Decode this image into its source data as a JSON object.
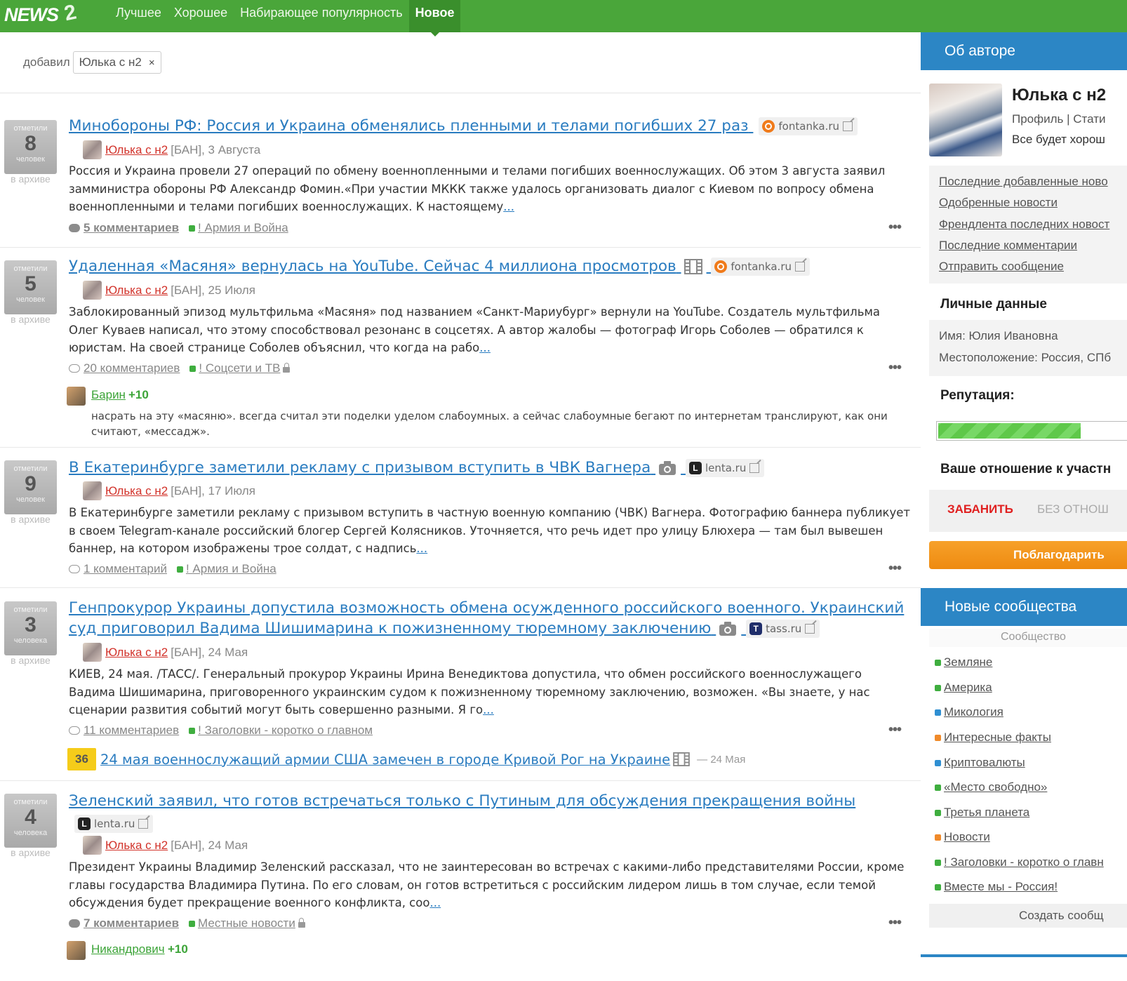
{
  "header": {
    "logo_text": "NEWS",
    "logo_badge": "2",
    "nav": [
      {
        "label": "Лучшее",
        "active": false
      },
      {
        "label": "Хорошее",
        "active": false
      },
      {
        "label": "Набирающее популярность",
        "active": false
      },
      {
        "label": "Новое",
        "active": true
      }
    ],
    "brand_color": "#4aa63a"
  },
  "filter": {
    "label": "добавил",
    "chip": "Юлька с н2",
    "clear": "×"
  },
  "news": [
    {
      "votes_top": "отметили",
      "votes": "8",
      "votes_bottom": "человек",
      "archive": "в архиве",
      "title": "Минобороны РФ: Россия и Украина обменялись пленными и телами погибших 27 раз",
      "media_icon": "",
      "source": "fontanka.ru",
      "source_icon": "fontanka-icon",
      "author": "Юлька с н2",
      "meta": "[БАН], 3 Августа",
      "text": "Россия и Украина провели 27 операций по обмену военнопленными и телами погибших военнослужащих. Об этом 3 августа заявил замминистра обороны РФ Александр Фомин.«При участии МККК также удалось организовать диалог с Киевом по вопросу обмена военнопленными и телами погибших военнослужащих. К настоящему",
      "more": "...",
      "comments": "5 комментариев",
      "category": "! Армия и Война",
      "category_locked": false
    },
    {
      "votes_top": "отметили",
      "votes": "5",
      "votes_bottom": "человек",
      "archive": "в архиве",
      "title": "Удаленная «Масяня» вернулась на YouTube. Сейчас 4 миллиона просмотров",
      "media_icon": "film-icon",
      "source": "fontanka.ru",
      "source_icon": "fontanka-icon",
      "author": "Юлька с н2",
      "meta": "[БАН], 25 Июля",
      "text": "Заблокированный эпизод мультфильма «Масяня» под названием «Санкт-Мариубург» вернули на YouTube. Создатель мультфильма Олег Куваев написал, что этому способствовал резонанс в соцсетях. А автор жалобы — фотограф Игорь Соболев — обратился к юристам. На своей странице Соболев объяснил, что когда на рабо",
      "more": "...",
      "comments": "20 комментариев",
      "category": "! Соцсети и ТВ",
      "category_locked": true,
      "comment": {
        "name": "Барин",
        "score": "+10",
        "text": "насрать на эту «масяню». всегда считал эти поделки уделом слабоумных. а сейчас слабоумные бегают по интернетам транслируют, как они считают, «мессадж»."
      }
    },
    {
      "votes_top": "отметили",
      "votes": "9",
      "votes_bottom": "человек",
      "archive": "в архиве",
      "title": "В Екатеринбурге заметили рекламу с призывом вступить в ЧВК Вагнера",
      "media_icon": "camera-icon",
      "source": "lenta.ru",
      "source_icon": "lenta-icon",
      "author": "Юлька с н2",
      "meta": "[БАН], 17 Июля",
      "text": " В Екатеринбурге заметили рекламу с призывом вступить в частную военную компанию (ЧВК) Вагнера. Фотографию баннера публикует в своем Telegram-канале российский блогер Сергей Колясников. Уточняется, что речь идет про улицу Блюхера — там был вывешен баннер, на котором изображены трое солдат, с надпись",
      "more": "...",
      "comments": "1 комментарий",
      "category": "! Армия и Война",
      "category_locked": false
    },
    {
      "votes_top": "отметили",
      "votes": "3",
      "votes_bottom": "человека",
      "archive": "в архиве",
      "title": "Генпрокурор Украины допустила возможность обмена осужденного российского военного. Украинский суд приговорил Вадима Шишимарина к пожизненному тюремному заключению",
      "media_icon": "camera-icon",
      "source": "tass.ru",
      "source_icon": "tass-icon",
      "author": "Юлька с н2",
      "meta": "[БАН], 24 Мая",
      "text": "КИЕВ, 24 мая. /ТАСС/. Генеральный прокурор Украины Ирина Венедиктова допустила, что обмен российского военнослужащего Вадима Шишимарина, приговоренного украинским судом к пожизненному тюремному заключению, возможен.  «Вы знаете, у нас сценарии развития событий могут быть совершенно разными. Я го",
      "more": "...",
      "comments": "11 комментариев",
      "category": "! Заголовки - коротко о главном",
      "category_locked": false,
      "related": {
        "count": "36",
        "title": "24 мая военнослужащий армии США замечен в городе Кривой Рог на Украине",
        "date": "— 24 Мая"
      }
    },
    {
      "votes_top": "отметили",
      "votes": "4",
      "votes_bottom": "человека",
      "archive": "в архиве",
      "title": "Зеленский заявил, что готов встречаться только с Путиным для обсуждения прекращения войны",
      "media_icon": "",
      "source": "lenta.ru",
      "source_icon": "lenta-icon",
      "author": "Юлька с н2",
      "meta": "[БАН], 24 Мая",
      "text": "Президент Украины Владимир Зеленский рассказал, что не заинтересован во встречах с какими-либо представителями России, кроме главы государства Владимира Путина. По его словам, он готов встретиться с российским лидером лишь в том случае, если темой обсуждения будет прекращение военного конфликта, соо",
      "more": "...",
      "comments": "7 комментариев",
      "category": "Местные новости",
      "category_locked": true,
      "comment": {
        "name": "Никандрович",
        "score": "+10",
        "text": ""
      }
    }
  ],
  "sidebar": {
    "about_title": "Об авторе",
    "name": "Юлька с н2",
    "profile_link": "Профиль",
    "links_sep": "|",
    "stats_link": "Стати",
    "status": "Все будет хорош",
    "links": [
      "Последние добавленные ново",
      "Одобренные новости",
      "Френдлента последних новост",
      "Последние комментарии",
      "Отправить сообщение"
    ],
    "personal_title": "Личные данные",
    "name_line": "Имя: Юлия Ивановна",
    "location_line": "Местоположение: Россия, СПб",
    "reputation_title": "Репутация:",
    "reputation_fraction": 0.71,
    "attitude_title": "Ваше отношение к участн",
    "ban_label": "ЗАБАНИТЬ",
    "neutral_label": "БЕЗ ОТНОШ",
    "thank_label": "Поблагодарить",
    "communities_title": "Новые сообщества",
    "communities_header": "Сообщество",
    "communities": [
      {
        "label": "Земляне",
        "color": "g"
      },
      {
        "label": "Америка",
        "color": "g"
      },
      {
        "label": "Микология",
        "color": "b"
      },
      {
        "label": "Интересные факты",
        "color": "o"
      },
      {
        "label": "Криптовалюты",
        "color": "b"
      },
      {
        "label": "«Место свободно»",
        "color": "g"
      },
      {
        "label": "Третья планета",
        "color": "g"
      },
      {
        "label": "Новости",
        "color": "o"
      },
      {
        "label": "! Заголовки - коротко о главн",
        "color": "g"
      },
      {
        "label": "Вместе мы - Россия!",
        "color": "g"
      }
    ],
    "create_label": "Создать сообщ"
  }
}
